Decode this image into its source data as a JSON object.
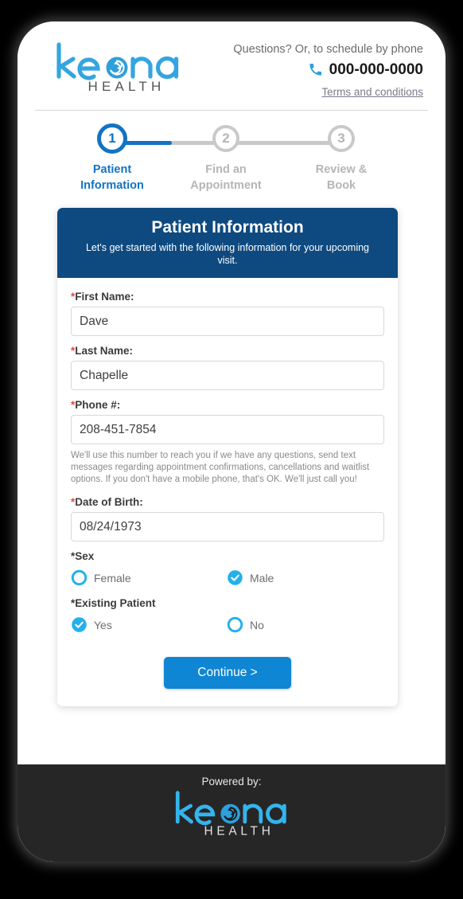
{
  "brand": {
    "logo_word": "keona",
    "logo_sub": "HEALTH",
    "logo_color": "#34a5e0",
    "logo_sub_color": "#555555"
  },
  "header": {
    "questions_text": "Questions? Or, to schedule by phone",
    "phone_number": "000-000-0000",
    "phone_icon": "phone-icon",
    "terms_link": "Terms and conditions"
  },
  "stepper": {
    "accent_color": "#1273c4",
    "idle_color": "#c9c9c9",
    "steps": [
      {
        "number": "1",
        "label": "Patient\nInformation",
        "line1": "Patient",
        "line2": "Information",
        "state": "active"
      },
      {
        "number": "2",
        "label": "Find an\nAppointment",
        "line1": "Find an",
        "line2": "Appointment",
        "state": "idle"
      },
      {
        "number": "3",
        "label": "Review &\nBook",
        "line1": "Review &",
        "line2": "Book",
        "state": "idle"
      }
    ]
  },
  "card": {
    "header_color": "#0e4a80",
    "title": "Patient Information",
    "subtitle": "Let's get started with the following information for your upcoming visit.",
    "fields": {
      "first_name": {
        "label": "First Name:",
        "required_mark": "*",
        "value": "Dave",
        "placeholder": ""
      },
      "last_name": {
        "label": "Last Name:",
        "required_mark": "*",
        "value": "Chapelle",
        "placeholder": ""
      },
      "phone": {
        "label": "Phone #:",
        "required_mark": "*",
        "value": "208-451-7854",
        "placeholder": "",
        "help_text": "We'll use this number to reach you if we have any questions, send text messages regarding appointment confirmations, cancellations and waitlist options. If you don't have a mobile phone, that's OK. We'll just call you!"
      },
      "dob": {
        "label": "Date of Birth:",
        "required_mark": "*",
        "value": "08/24/1973",
        "placeholder": ""
      }
    },
    "sex": {
      "label": "Sex",
      "required_mark": "*",
      "options": [
        {
          "label": "Female",
          "selected": false
        },
        {
          "label": "Male",
          "selected": true
        }
      ]
    },
    "existing_patient": {
      "label": "Existing Patient",
      "required_mark": "*",
      "options": [
        {
          "label": "Yes",
          "selected": true
        },
        {
          "label": "No",
          "selected": false
        }
      ]
    },
    "continue_button": "Continue >",
    "button_color": "#0f86d3",
    "radio_color": "#24b0ec"
  },
  "footer": {
    "background_color": "#262626",
    "powered_by": "Powered by:",
    "logo_word": "keona",
    "logo_sub": "HEALTH",
    "logo_color": "#34b4ec",
    "logo_sub_color": "#e0e0e0"
  }
}
